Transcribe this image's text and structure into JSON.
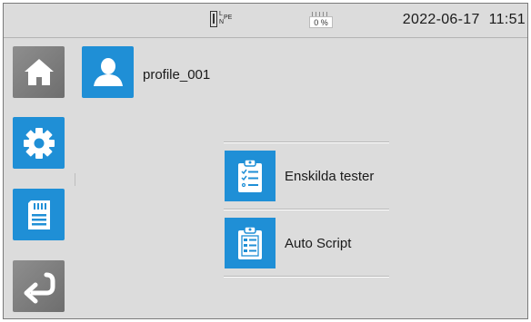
{
  "status": {
    "plug_labels": {
      "l": "L",
      "n": "N",
      "pe": "PE"
    },
    "battery_percent": "0 %",
    "date": "2022-06-17",
    "time": "11:51"
  },
  "sidebar": {
    "items": [
      {
        "icon": "home-icon"
      },
      {
        "icon": "gear-icon"
      },
      {
        "icon": "memory-card-icon"
      },
      {
        "icon": "back-arrow-icon"
      }
    ]
  },
  "profile": {
    "icon": "user-icon",
    "name": "profile_001"
  },
  "menu": {
    "items": [
      {
        "icon": "checklist-clipboard-icon",
        "label": "Enskilda tester"
      },
      {
        "icon": "script-clipboard-icon",
        "label": "Auto Script"
      }
    ]
  },
  "colors": {
    "accent": "#1f8fd6",
    "background": "#dcdcdc",
    "inactive_button": "#7c7c7c"
  }
}
